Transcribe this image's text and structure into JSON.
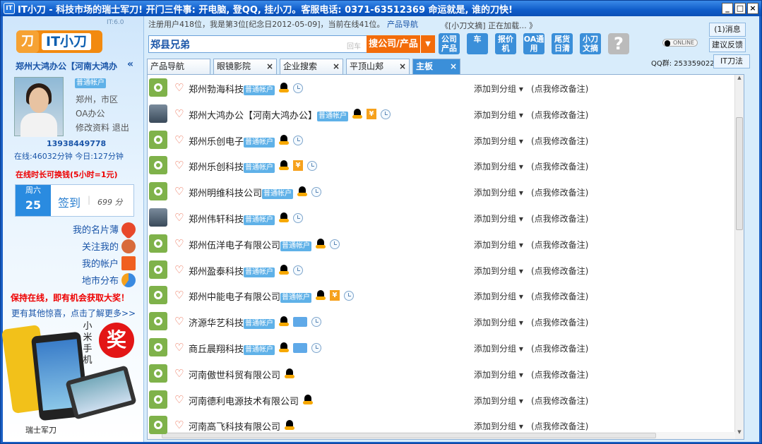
{
  "titlebar": {
    "title": "IT小刀 - 科技市场的瑞士军刀! 开门三件事: 开电脑, 登QQ, 挂小刀。客服电话: 0371-63512369 命运就是, 谁的刀快!",
    "icon_text": "IT"
  },
  "version": "IT:6.0",
  "logo": {
    "mark": "刀",
    "text": "IT小刀"
  },
  "user": {
    "name": "郑州大鸿办公【河南大鸿办",
    "badge": "普通帐户",
    "city": "郑州，市区",
    "category": "OA办公",
    "edit": "修改资料",
    "logout": "退出",
    "phone": "13938449778",
    "online": "在线:46032分钟 今日:127分钟"
  },
  "promo_top": "在线时长可换钱(5小时=1元)",
  "signin": {
    "weekday": "周六",
    "day": "25",
    "button": "签到",
    "points": "699 分"
  },
  "menu": [
    {
      "label": "我的名片薄",
      "icon": "heart-icon",
      "color": "#e8482a"
    },
    {
      "label": "关注我的",
      "icon": "people-icon",
      "color": "#d86a3a"
    },
    {
      "label": "我的帐户",
      "icon": "cart-icon",
      "color": "#f06020"
    },
    {
      "label": "地市分布",
      "icon": "pie-icon",
      "color": "#3a8ae0"
    }
  ],
  "promo_online": "保持在线，即有机会获取大奖！",
  "promo_more": "更有其他惊喜，点击了解更多>>",
  "ad": {
    "mi": "小米手机",
    "prize": "奖",
    "footer": "瑞士军刀"
  },
  "stats": {
    "text": "注册用户418位，我是第3位[纪念日2012-05-09]，当前在线41位。",
    "link": "产品导航"
  },
  "news": "《[小刀文摘] 正在加载... 》",
  "search": {
    "value": "郑县兄弟",
    "hint": "回车",
    "button": "搜公司/产品"
  },
  "toolbar": [
    {
      "label": "公司产品",
      "color": "#3b8fd9"
    },
    {
      "label": "车",
      "color": "#3b8fd9"
    },
    {
      "label": "报价机",
      "color": "#3b8fd9"
    },
    {
      "label": "OA通用",
      "color": "#3b8fd9"
    },
    {
      "label": "尾货日清",
      "color": "#3b8fd9"
    },
    {
      "label": "小刀文摘",
      "color": "#3b8fd9"
    }
  ],
  "right": {
    "messages": "(1)消息",
    "feedback": "建议反馈",
    "qq_online": "ONLINE",
    "qq_group": "QQ群: 253359022",
    "it_rules": "IT刀法"
  },
  "tabs": [
    {
      "label": "产品导航",
      "closable": false
    },
    {
      "label": "眼镜影院",
      "closable": true
    },
    {
      "label": "企业搜索",
      "closable": true
    },
    {
      "label": "平顶山郏",
      "closable": true
    },
    {
      "label": "主板",
      "closable": true,
      "active": true
    }
  ],
  "rows": [
    {
      "name": "郑州勃海科技",
      "badge": "普通帐户",
      "avatar": "green",
      "icons": [
        "qq",
        "clock"
      ]
    },
    {
      "name": "郑州大鸿办公【河南大鸿办公】",
      "badge": "普通帐户",
      "avatar": "photo",
      "icons": [
        "qq",
        "yen",
        "clock"
      ]
    },
    {
      "name": "郑州乐创电子",
      "badge": "普通帐户",
      "avatar": "green",
      "icons": [
        "qq",
        "clock"
      ]
    },
    {
      "name": "郑州乐创科技",
      "badge": "普通帐户",
      "avatar": "green",
      "icons": [
        "qq",
        "yen",
        "clock"
      ]
    },
    {
      "name": "郑州明维科技公司",
      "badge": "普通帐户",
      "avatar": "green",
      "icons": [
        "qq",
        "clock"
      ]
    },
    {
      "name": "郑州伟轩科技",
      "badge": "普通帐户",
      "avatar": "photo",
      "icons": [
        "qq",
        "clock"
      ]
    },
    {
      "name": "郑州伍洋电子有限公司",
      "badge": "普通帐户",
      "avatar": "green",
      "icons": [
        "qq",
        "clock"
      ]
    },
    {
      "name": "郑州盈泰科技",
      "badge": "普通帐户",
      "avatar": "green",
      "icons": [
        "qq",
        "clock"
      ]
    },
    {
      "name": "郑州中能电子有限公司",
      "badge": "普通帐户",
      "avatar": "green",
      "icons": [
        "qq",
        "yen",
        "clock"
      ]
    },
    {
      "name": "济源华艺科技",
      "badge": "普通帐户",
      "avatar": "green",
      "icons": [
        "qq",
        "card",
        "clock"
      ]
    },
    {
      "name": "商丘晨翔科技",
      "badge": "普通帐户",
      "avatar": "green",
      "icons": [
        "qq",
        "card",
        "clock"
      ]
    },
    {
      "name": "河南傲世科贸有限公司",
      "badge": "",
      "avatar": "green",
      "icons": [
        "qq"
      ]
    },
    {
      "name": "河南德利电源技术有限公司",
      "badge": "",
      "avatar": "green",
      "icons": [
        "qq"
      ]
    },
    {
      "name": "河南高飞科技有限公司",
      "badge": "",
      "avatar": "green",
      "icons": [
        "qq"
      ]
    }
  ],
  "row_actions": {
    "group": "添加到分组",
    "note": "(点我修改备注)"
  }
}
